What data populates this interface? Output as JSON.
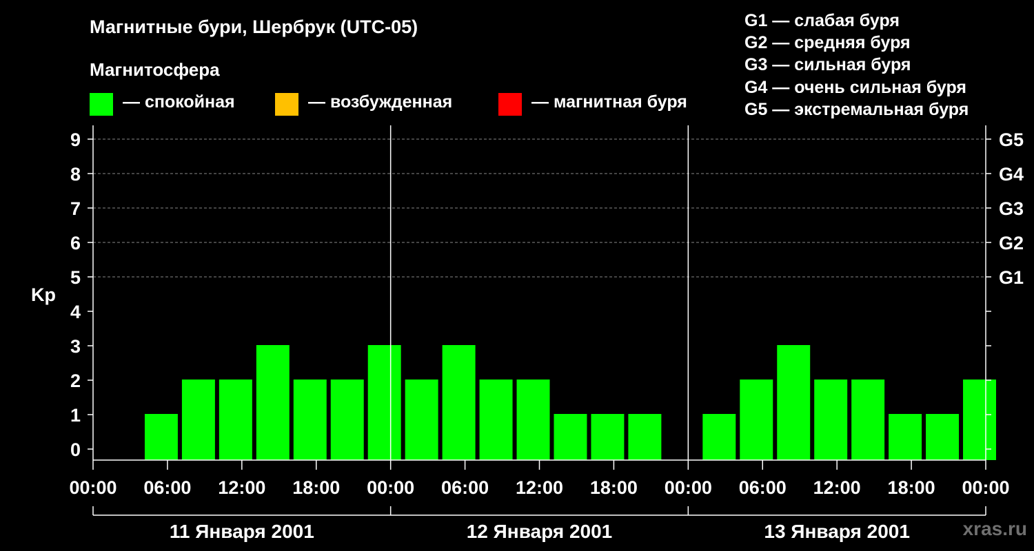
{
  "title": "Магнитные бури, Шербрук (UTC-05)",
  "magnetosphere_label": "Магнитосфера",
  "legend": [
    {
      "color": "#00ff00",
      "label": "— спокойная"
    },
    {
      "color": "#ffc000",
      "label": "— возбужденная"
    },
    {
      "color": "#ff0000",
      "label": "— магнитная буря"
    }
  ],
  "g_scale": [
    "G1 — слабая буря",
    "G2 — средняя буря",
    "G3 — сильная буря",
    "G4 — очень сильная буря",
    "G5 — экстремальная буря"
  ],
  "watermark": "xras.ru",
  "chart_data": {
    "type": "bar",
    "ylabel": "Kp",
    "ylim": [
      0,
      9
    ],
    "yticks": [
      "0",
      "1",
      "2",
      "3",
      "4",
      "5",
      "6",
      "7",
      "8",
      "9"
    ],
    "right_axis_labels": [
      {
        "kp": 5,
        "label": "G1"
      },
      {
        "kp": 6,
        "label": "G2"
      },
      {
        "kp": 7,
        "label": "G3"
      },
      {
        "kp": 8,
        "label": "G4"
      },
      {
        "kp": 9,
        "label": "G5"
      }
    ],
    "grid": "dashed at Kp 5-9",
    "bar_color": "#00ff00",
    "x_tick_labels": [
      "00:00",
      "06:00",
      "12:00",
      "18:00",
      "00:00",
      "06:00",
      "12:00",
      "18:00",
      "00:00",
      "06:00",
      "12:00",
      "18:00",
      "00:00"
    ],
    "days": [
      {
        "date": "11 Января 2001",
        "kp": [
          null,
          1,
          2,
          2,
          3,
          2,
          2,
          3
        ]
      },
      {
        "date": "12 Января 2001",
        "kp": [
          2,
          3,
          2,
          2,
          1,
          1,
          1,
          null
        ]
      },
      {
        "date": "13 Января 2001",
        "kp": [
          1,
          2,
          3,
          2,
          2,
          1,
          1,
          2
        ]
      }
    ]
  }
}
